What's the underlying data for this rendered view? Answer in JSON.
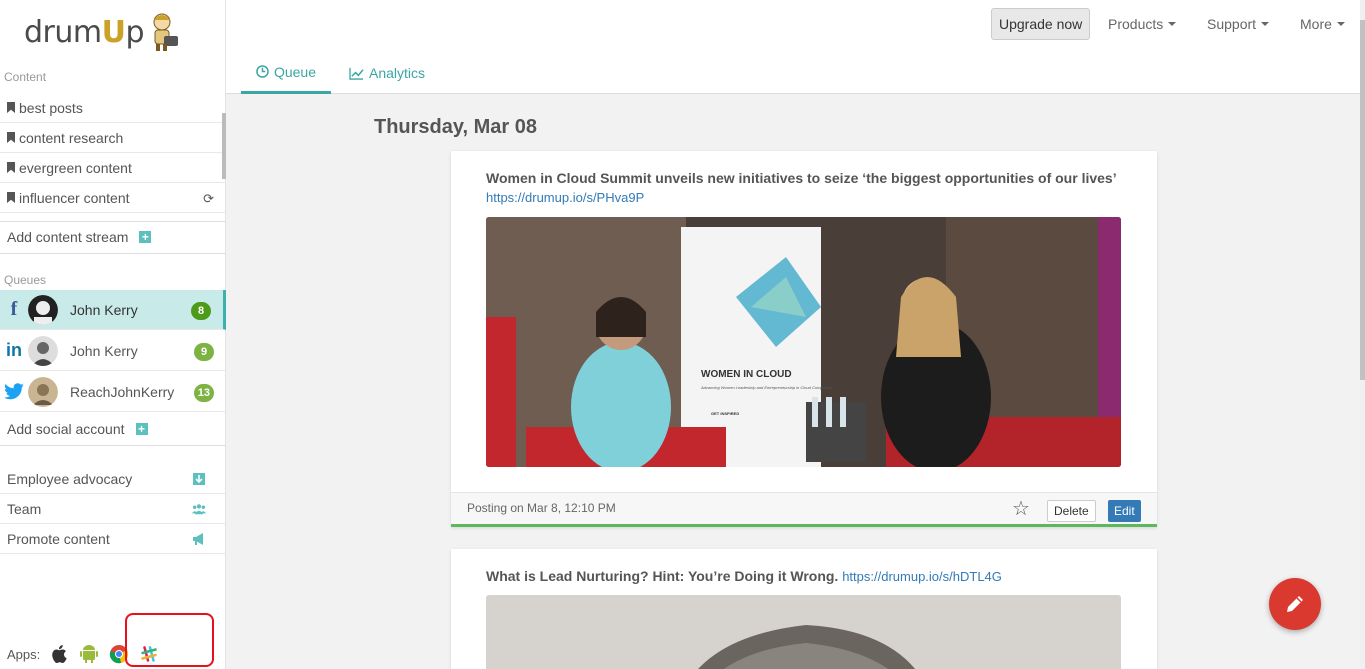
{
  "logo": {
    "text_a": "drum",
    "text_u": "U",
    "text_b": "p"
  },
  "sidebar": {
    "content_label": "Content",
    "streams": [
      {
        "label": "best posts"
      },
      {
        "label": "content research"
      },
      {
        "label": "evergreen content"
      },
      {
        "label": "influencer content"
      }
    ],
    "add_stream": "Add content stream",
    "queues_label": "Queues",
    "queues": [
      {
        "network": "facebook",
        "name": "John Kerry",
        "count": "8",
        "badge_color": "#4e9a1b"
      },
      {
        "network": "linkedin",
        "name": "John Kerry",
        "count": "9",
        "badge_color": "#7cb342"
      },
      {
        "network": "twitter",
        "name": "ReachJohnKerry",
        "count": "13",
        "badge_color": "#7cb342"
      }
    ],
    "add_social": "Add social account",
    "tools": [
      {
        "label": "Employee advocacy",
        "icon": "download-icon"
      },
      {
        "label": "Team",
        "icon": "users-icon"
      },
      {
        "label": "Promote content",
        "icon": "megaphone-icon"
      }
    ],
    "apps_label": "Apps:"
  },
  "topbar": {
    "upgrade": "Upgrade now",
    "products": "Products",
    "support": "Support",
    "more": "More",
    "tabs": [
      {
        "label": "Queue"
      },
      {
        "label": "Analytics"
      }
    ]
  },
  "main": {
    "date": "Thursday, Mar 08",
    "posts": [
      {
        "title": "Women in Cloud Summit unveils new initiatives to seize ‘the biggest opportunities of our lives’",
        "link": "https://drumup.io/s/PHva9P",
        "posting": "Posting on Mar 8, 12:10 PM",
        "delete": "Delete",
        "edit": "Edit",
        "banner_title": "WOMEN IN CLOUD",
        "banner_sub": "Advancing Women Leadership and Entrepreneurship in Cloud Computing",
        "banner_item": "GET INSPIRED"
      },
      {
        "title": "What is Lead Nurturing? Hint: You’re Doing it Wrong.",
        "link": "https://drumup.io/s/hDTL4G"
      }
    ]
  },
  "colors": {
    "accent": "#3aa7a4",
    "edit": "#337ab7",
    "fab": "#d9392f",
    "highlight": "#e8101a"
  }
}
